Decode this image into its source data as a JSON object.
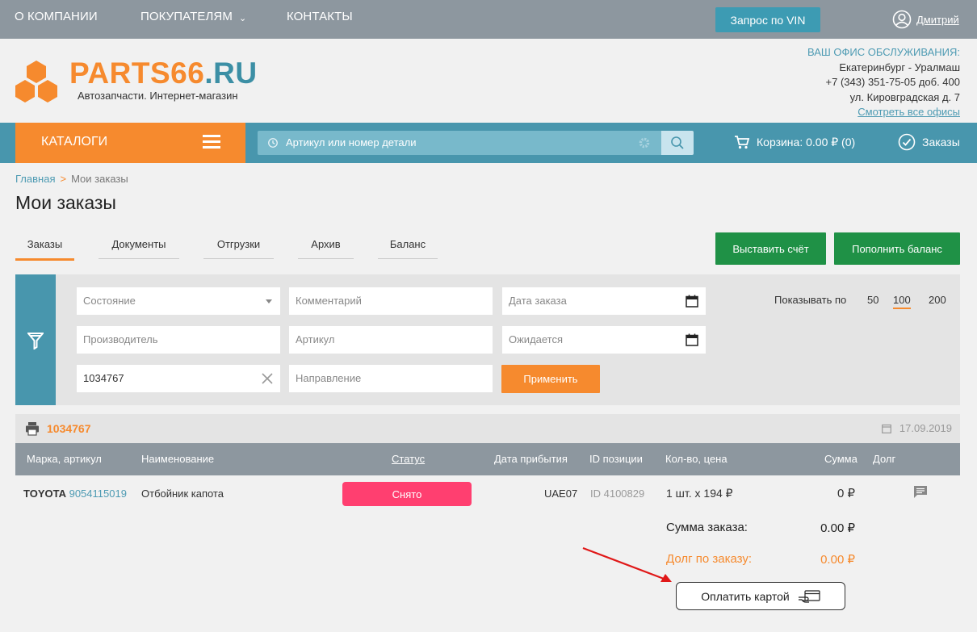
{
  "topnav": {
    "about": "О КОМПАНИИ",
    "buyers": "ПОКУПАТЕЛЯМ",
    "contacts": "КОНТАКТЫ",
    "vin_button": "Запрос по VIN",
    "user_name": "Дмитрий"
  },
  "header": {
    "logo_a": "PARTS66",
    "logo_b": ".RU",
    "logo_sub": "Автозапчасти. Интернет-магазин",
    "office_title": "ВАШ ОФИС ОБСЛУЖИВАНИЯ:",
    "office_city": "Екатеринбург - Уралмаш",
    "office_phone": "+7 (343) 351-75-05 доб. 400",
    "office_address": "ул. Кировградская д. 7",
    "office_link": "Смотреть все офисы"
  },
  "mainbar": {
    "catalogs": "КАТАЛОГИ",
    "search_placeholder": "Артикул или номер детали",
    "cart": "Корзина: 0.00 ₽ (0)",
    "orders": "Заказы"
  },
  "breadcrumb": {
    "home": "Главная",
    "sep": ">",
    "current": "Мои заказы"
  },
  "page_title": "Мои заказы",
  "tabs": [
    "Заказы",
    "Документы",
    "Отгрузки",
    "Архив",
    "Баланс"
  ],
  "actions": {
    "invoice": "Выставить счёт",
    "topup": "Пополнить баланс"
  },
  "filter": {
    "state": "Состояние",
    "comment": "Комментарий",
    "order_date": "Дата заказа",
    "manufacturer": "Производитель",
    "article": "Артикул",
    "expected": "Ожидается",
    "search_value": "1034767",
    "direction": "Направление",
    "apply": "Применить",
    "show_by": "Показывать по",
    "page_sizes": [
      "50",
      "100",
      "200"
    ],
    "selected_page_size": "100"
  },
  "order": {
    "number": "1034767",
    "date": "17.09.2019",
    "columns": {
      "brand": "Марка, артикул",
      "name": "Наименование",
      "status": "Статус",
      "arrival": "Дата прибытия",
      "position_id": "ID позиции",
      "qty_price": "Кол-во, цена",
      "sum": "Сумма",
      "debt": "Долг"
    },
    "row": {
      "brand": "TOYOTA",
      "article": "9054115019",
      "name": "Отбойник капота",
      "status": "Снято",
      "arrival": "UAE07",
      "position_id": "ID 4100829",
      "qty_price": "1 шт. x 194 ₽",
      "sum": "0 ₽"
    },
    "total_label": "Сумма заказа:",
    "total_value": "0.00 ₽",
    "debt_label": "Долг по заказу:",
    "debt_value": "0.00 ₽",
    "pay_button": "Оплатить картой"
  },
  "colors": {
    "orange": "#f68a2e",
    "teal": "#4896ad",
    "green": "#1f9146",
    "status_red": "#ff3f70",
    "gray_bar": "#8d979f"
  }
}
